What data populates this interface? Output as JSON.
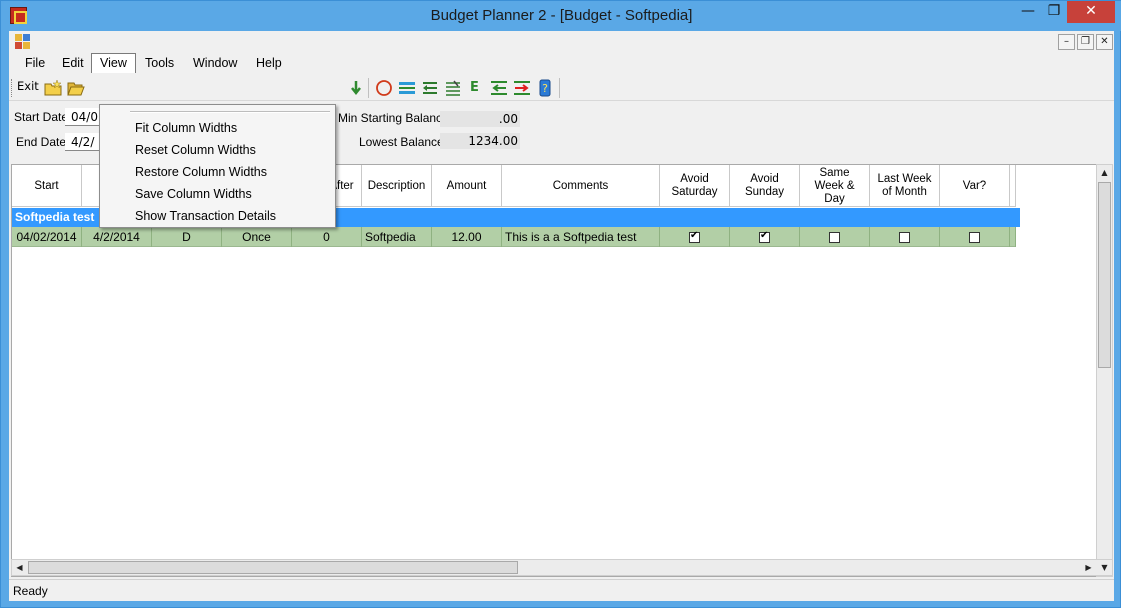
{
  "window": {
    "title": "Budget Planner 2 - [Budget - Softpedia]",
    "controls": {
      "minimize": "—",
      "maximize": "❐",
      "close": "✕"
    }
  },
  "mdi": {
    "minimize": "–",
    "restore": "❐",
    "close": "✕"
  },
  "menubar": {
    "items": [
      "File",
      "Edit",
      "View",
      "Tools",
      "Window",
      "Help"
    ]
  },
  "view_menu": {
    "items": [
      "Fit Column Widths",
      "Reset Column Widths",
      "Restore Column Widths",
      "Save Column Widths",
      "Show Transaction Details"
    ]
  },
  "toolbar": {
    "exit_label": "Exit",
    "e_label": "E"
  },
  "form": {
    "start_date_label": "Start Date",
    "start_date_value": "04/0",
    "end_date_label": "End Date",
    "end_date_value": "4/2/",
    "min_starting_balance_label": "Min Starting Balance",
    "min_starting_balance_value": ".00",
    "lowest_balance_label": "Lowest Balance",
    "lowest_balance_value": "1234.00"
  },
  "grid": {
    "headers": [
      "Start",
      "",
      "",
      "",
      "After",
      "Description",
      "Amount",
      "Comments",
      "Avoid\nSaturday",
      "Avoid\nSunday",
      "Same\nWeek &\nDay",
      "Last Week\nof Month",
      "Var?"
    ],
    "group_label": "Softpedia test",
    "row": {
      "start": "04/02/2014",
      "date": "4/2/2014",
      "type": "D",
      "frequency": "Once",
      "after": "0",
      "description": "Softpedia",
      "amount": "12.00",
      "comments": "This is a a Softpedia test"
    }
  },
  "status": {
    "text": "Ready"
  },
  "colors": {
    "group_row": "#3399ff",
    "data_row": "#b2cfa6",
    "titlebar": "#5aa8e6",
    "close_button": "#c7413a"
  }
}
